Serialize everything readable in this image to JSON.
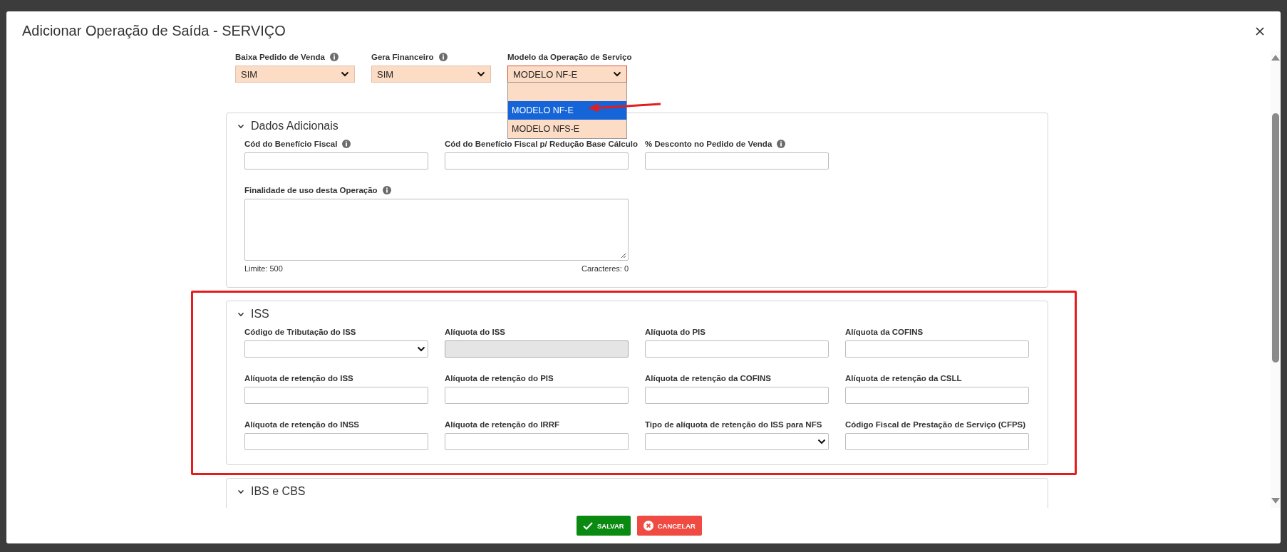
{
  "dialog": {
    "title": "Adicionar Operação de Saída - SERVIÇO"
  },
  "top_fields": [
    {
      "label": "Baixa Pedido de Venda",
      "info": true,
      "value": "SIM",
      "expanded": false
    },
    {
      "label": "Gera Financeiro",
      "info": true,
      "value": "SIM",
      "expanded": false
    },
    {
      "label": "Modelo da Operação de Serviço",
      "info": false,
      "value": "MODELO NF-E",
      "expanded": true,
      "options": [
        {
          "label": "MODELO NF-E",
          "selected": true
        },
        {
          "label": "MODELO NFS-E",
          "selected": false
        }
      ]
    }
  ],
  "sections": [
    {
      "title": "Dados Adicionais",
      "expanded": true,
      "fields": [
        {
          "kind": "text",
          "label": "Cód do Benefício Fiscal",
          "info": true
        },
        {
          "kind": "text",
          "label": "Cód do Benefício Fiscal p/ Redução Base Cálculo",
          "info": false
        },
        {
          "kind": "text",
          "label": "% Desconto no Pedido de Venda",
          "info": true
        },
        {
          "kind": "textarea",
          "label": "Finalidade de uso desta Operação",
          "info": true,
          "limit": "Limite: 500",
          "count": "Caracteres: 0"
        }
      ]
    },
    {
      "title": "ISS",
      "expanded": true,
      "highlighted": true,
      "fields": [
        {
          "kind": "select",
          "label": "Código de Tributação do ISS",
          "info": false
        },
        {
          "kind": "text",
          "label": "Alíquota do ISS",
          "info": false,
          "disabled": true
        },
        {
          "kind": "text",
          "label": "Alíquota do PIS",
          "info": false
        },
        {
          "kind": "text",
          "label": "Alíquota da COFINS",
          "info": false
        },
        {
          "kind": "text",
          "label": "Alíquota de retenção do ISS",
          "info": false
        },
        {
          "kind": "text",
          "label": "Alíquota de retenção do PIS",
          "info": false
        },
        {
          "kind": "text",
          "label": "Alíquota de retenção da COFINS",
          "info": false
        },
        {
          "kind": "text",
          "label": "Alíquota de retenção da CSLL",
          "info": false
        },
        {
          "kind": "text",
          "label": "Alíquota de retenção do INSS",
          "info": false
        },
        {
          "kind": "text",
          "label": "Alíquota de retenção do IRRF",
          "info": false
        },
        {
          "kind": "select",
          "label": "Tipo de alíquota de retenção do ISS para NFS",
          "info": false
        },
        {
          "kind": "text",
          "label": "Código Fiscal de Prestação de Serviço (CFPS)",
          "info": false
        }
      ]
    },
    {
      "title": "IBS e CBS",
      "expanded": true
    }
  ],
  "buttons": [
    {
      "kind": "save",
      "label": "SALVAR"
    },
    {
      "kind": "cancel",
      "label": "CANCELAR"
    }
  ]
}
